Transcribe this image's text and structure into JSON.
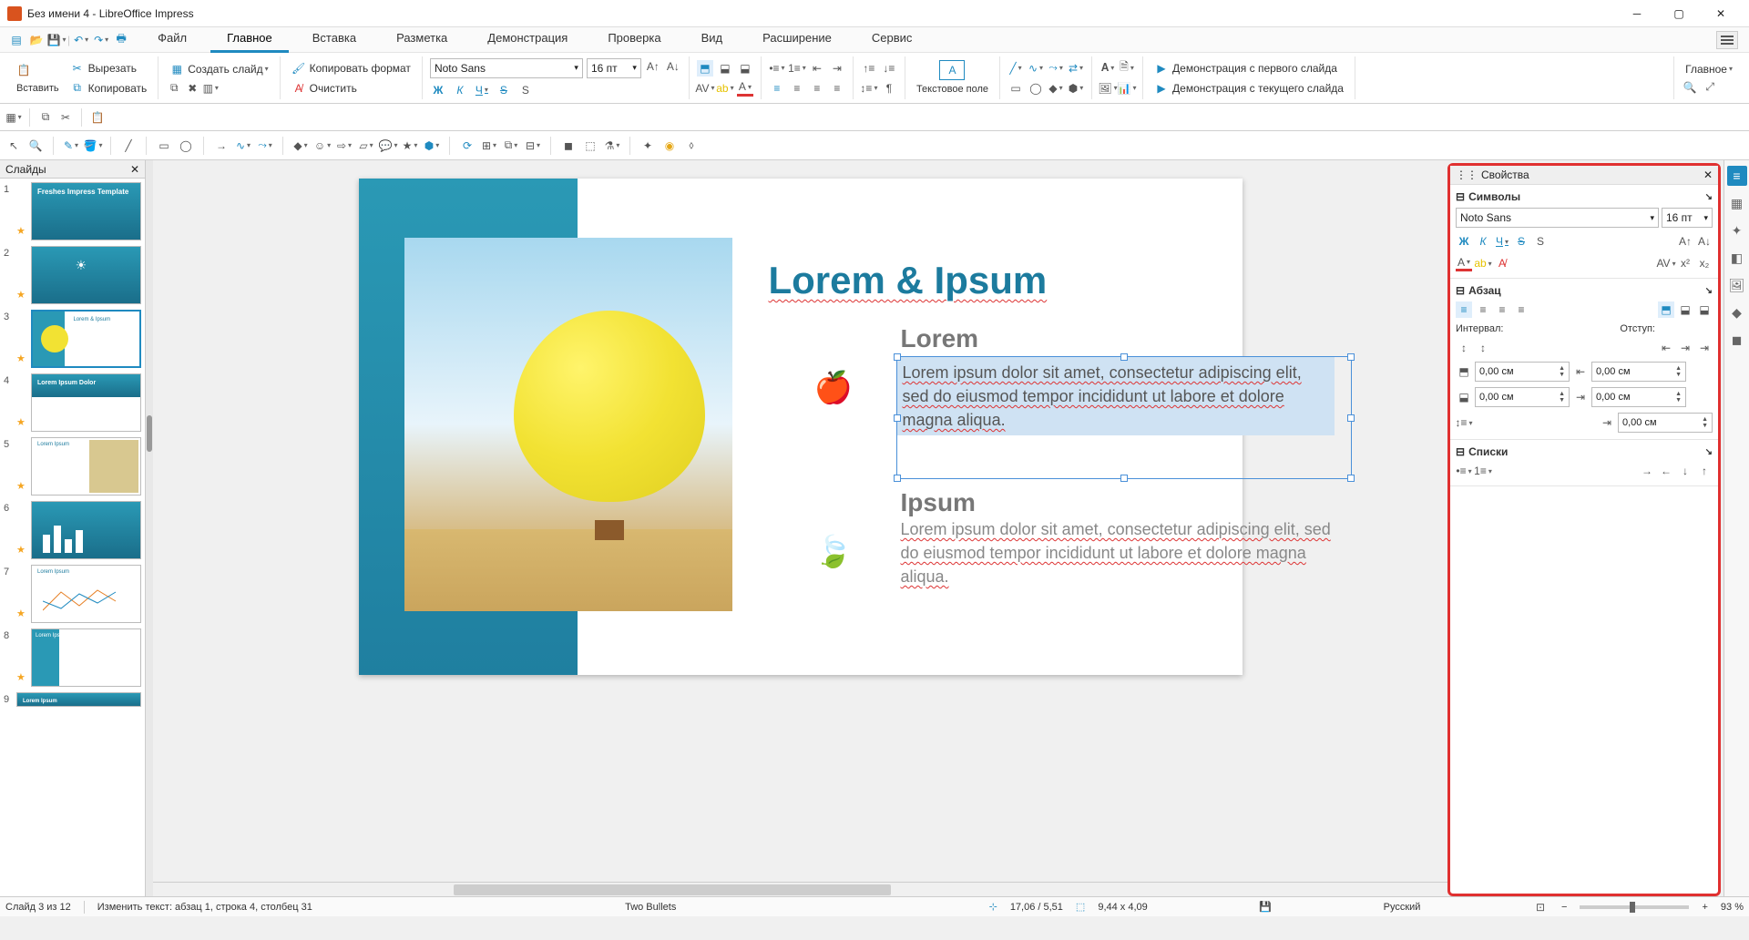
{
  "window": {
    "title": "Без имени 4 - LibreOffice Impress"
  },
  "menus": {
    "file": "Файл",
    "main": "Главное",
    "insert": "Вставка",
    "layout": "Разметка",
    "demo": "Демонстрация",
    "review": "Проверка",
    "view": "Вид",
    "extension": "Расширение",
    "service": "Сервис"
  },
  "ribbon": {
    "paste": "Вставить",
    "cut": "Вырезать",
    "copy": "Копировать",
    "newslide": "Создать слайд",
    "copyformat": "Копировать формат",
    "clear": "Очистить",
    "font_name": "Noto Sans",
    "font_size": "16 пт",
    "textbox": "Текстовое поле",
    "demo_first": "Демонстрация с первого слайда",
    "demo_current": "Демонстрация с текущего слайда",
    "main_btn": "Главное"
  },
  "slidepanel": {
    "title": "Слайды"
  },
  "slide": {
    "title": "Lorem & Ipsum",
    "h1": "Lorem",
    "p1": "Lorem ipsum dolor sit amet, consectetur adipiscing elit, sed do eiusmod tempor incididunt ut labore et dolore magna aliqua.",
    "h2": "Ipsum",
    "p2": "Lorem ipsum dolor sit amet, consectetur adipiscing elit, sed do eiusmod tempor incididunt ut labore et dolore magna aliqua."
  },
  "props": {
    "title": "Свойства",
    "symbols": "Символы",
    "font_name": "Noto Sans",
    "font_size": "16 пт",
    "para": "Абзац",
    "interval": "Интервал:",
    "indent": "Отступ:",
    "val_zero": "0,00 см",
    "lists": "Списки"
  },
  "thumbs": {
    "t1": "Freshes Impress Template",
    "t2": "",
    "t3": "Lorem & Ipsum",
    "t4": "Lorem Ipsum Dolor",
    "t5": "Lorem Ipsum",
    "t6": "",
    "t7": "Lorem Ipsum",
    "t8": "Lorem Ipsum",
    "t9": "Lorem Ipsum"
  },
  "status": {
    "slide_of": "Слайд 3 из 12",
    "edit": "Изменить текст: абзац 1, строка 4, столбец 31",
    "layout": "Two Bullets",
    "coords": "17,06 / 5,51",
    "size": "9,44 x 4,09",
    "lang": "Русский",
    "zoom": "93 %"
  }
}
